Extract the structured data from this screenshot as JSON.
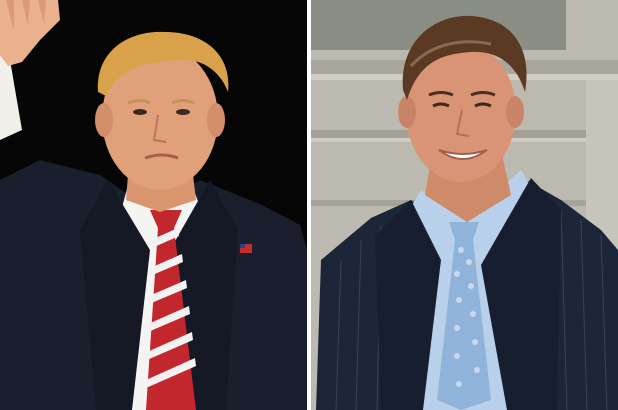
{
  "photos": [
    {
      "id": "left",
      "background": "#060606",
      "suit": "#1a1f2d",
      "tie_colors": [
        "#c1272d",
        "#f2f2f2"
      ],
      "hair": "#d9a24a"
    },
    {
      "id": "right",
      "background": "#b9b6ad",
      "suit": "#1d2538",
      "tie_colors": [
        "#8fb3d9",
        "#c9d8ea"
      ],
      "hair": "#5a3a22"
    }
  ],
  "divider_color": "#ffffff"
}
